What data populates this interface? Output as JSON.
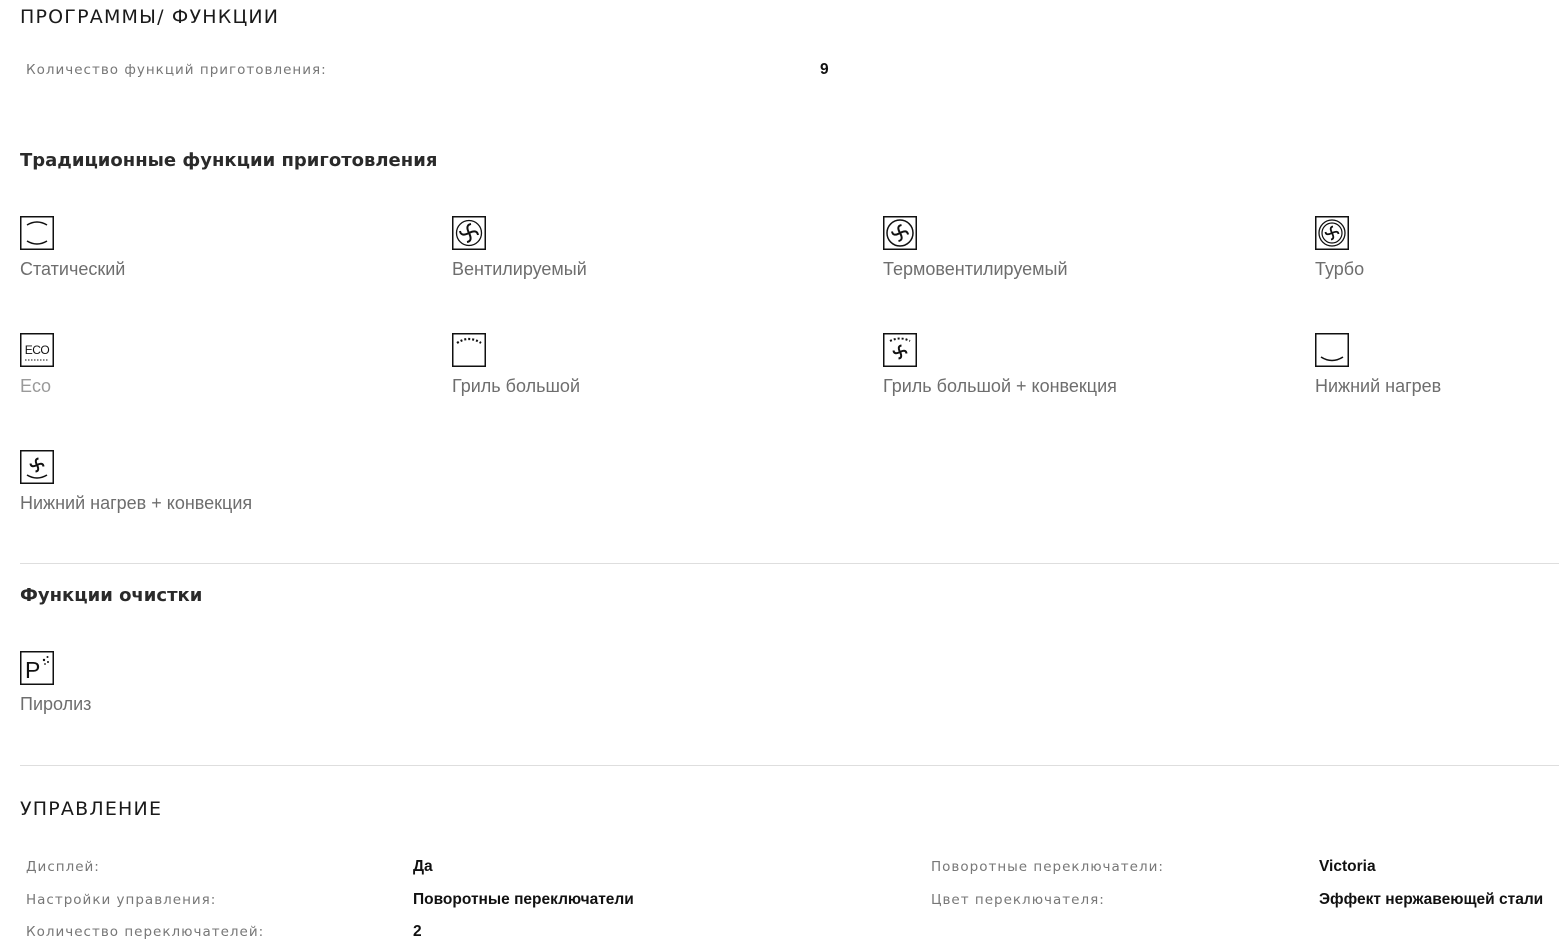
{
  "programs": {
    "title": "ПРОГРАММЫ/ ФУНКЦИИ",
    "count_label": "Количество функций приготовления:",
    "count_value": "9"
  },
  "traditional": {
    "title": "Традиционные функции приготовления",
    "items": [
      {
        "label": "Статический",
        "icon": "static-heat-icon"
      },
      {
        "label": "Вентилируемый",
        "icon": "fan-icon"
      },
      {
        "label": "Термовентилируемый",
        "icon": "fan-circle-icon"
      },
      {
        "label": "Турбо",
        "icon": "turbo-fan-icon"
      },
      {
        "label": "Eco",
        "icon": "eco-icon"
      },
      {
        "label": "Гриль большой",
        "icon": "large-grill-icon"
      },
      {
        "label": "Гриль большой + конвекция",
        "icon": "grill-fan-icon"
      },
      {
        "label": "Нижний нагрев",
        "icon": "bottom-heat-icon"
      },
      {
        "label": "Нижний нагрев + конвекция",
        "icon": "bottom-heat-fan-icon"
      }
    ]
  },
  "cleaning": {
    "title": "Функции очистки",
    "items": [
      {
        "label": "Пиролиз",
        "icon": "pyrolysis-icon"
      }
    ]
  },
  "control": {
    "title": "УПРАВЛЕНИЕ",
    "left": [
      {
        "label": "Дисплей:",
        "value": "Да"
      },
      {
        "label": "Настройки управления:",
        "value": "Поворотные переключатели"
      },
      {
        "label": "Количество переключателей:",
        "value": "2"
      }
    ],
    "right": [
      {
        "label": "Поворотные переключатели:",
        "value": "Victoria"
      },
      {
        "label": "Цвет переключателя:",
        "value": "Эффект нержавеющей стали"
      }
    ]
  },
  "icon_text": {
    "eco": "ECO",
    "pyrolysis": "P"
  }
}
